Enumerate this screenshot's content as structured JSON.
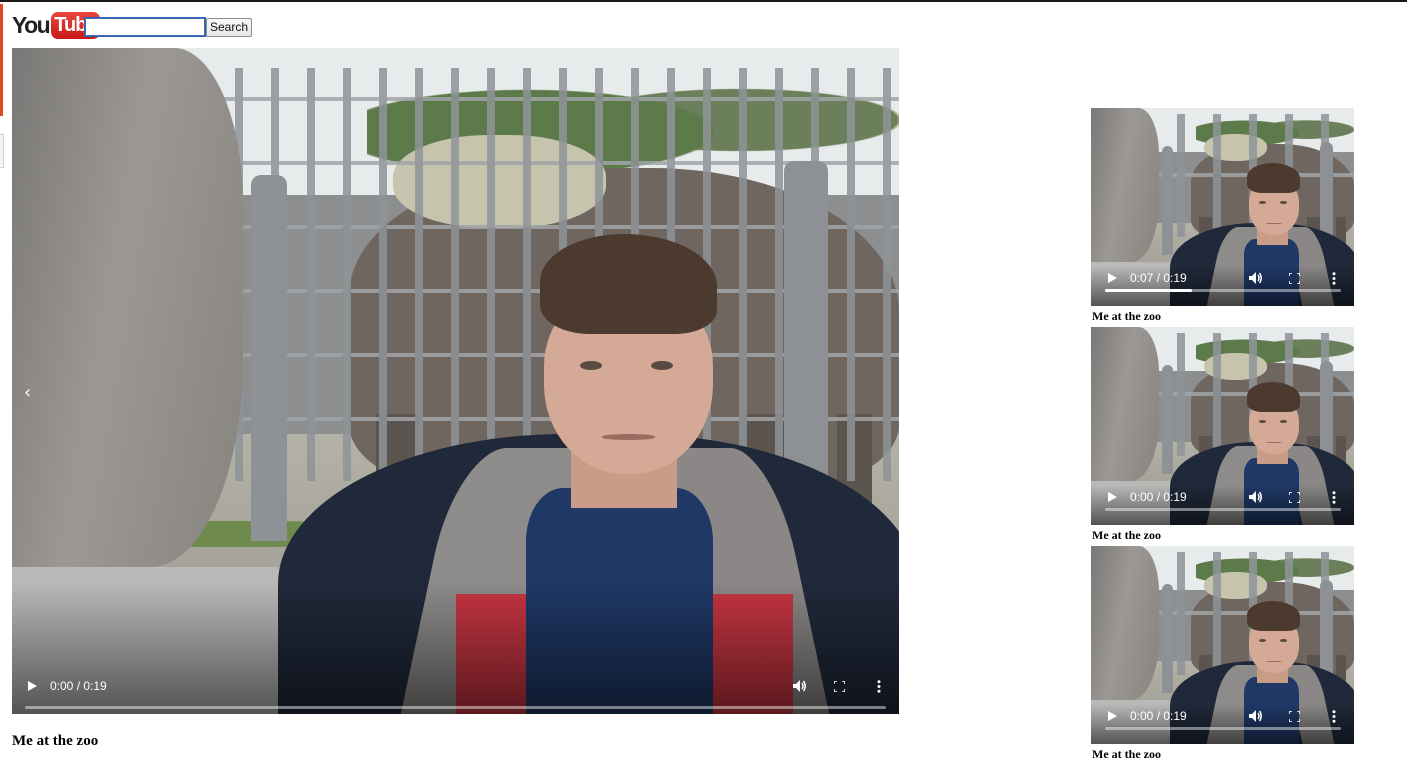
{
  "header": {
    "logo_you": "You",
    "logo_tube": "Tube",
    "search_value": "",
    "search_button_label": "Search"
  },
  "main_video": {
    "title": "Me at the zoo",
    "time": "0:00 / 0:19",
    "progress": 0.0,
    "icons": [
      "play-icon",
      "volume-icon",
      "fullscreen-icon",
      "more-options-icon",
      "chevron-left-icon"
    ]
  },
  "related_videos": [
    {
      "title": "Me at the zoo",
      "time": "0:07 / 0:19",
      "progress": 0.37
    },
    {
      "title": "Me at the zoo",
      "time": "0:00 / 0:19",
      "progress": 0.0
    },
    {
      "title": "Me at the zoo",
      "time": "0:00 / 0:19",
      "progress": 0.0
    }
  ],
  "colors": {
    "logo_red": "#d3231e",
    "accent_bar": "#e0481f",
    "player_background": "#000000"
  }
}
